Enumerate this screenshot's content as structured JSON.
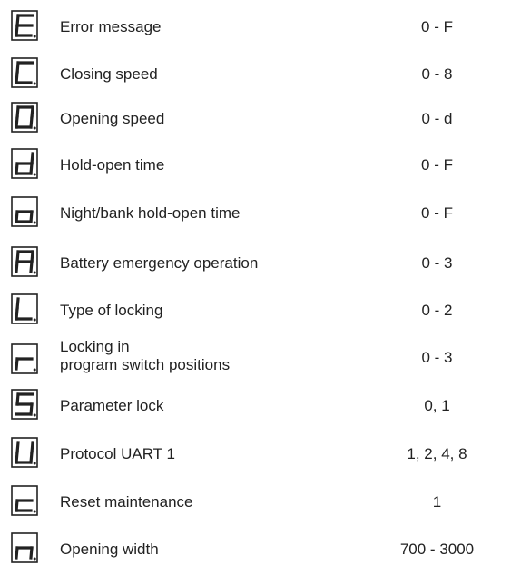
{
  "parameters": [
    {
      "symbol": "E",
      "label": "Error message",
      "range": "0 - F"
    },
    {
      "symbol": "C",
      "label": "Closing speed",
      "range": "0 - 8"
    },
    {
      "symbol": "O",
      "label": "Opening speed",
      "range": "0 - d"
    },
    {
      "symbol": "d",
      "label": "Hold-open time",
      "range": "0 - F"
    },
    {
      "symbol": "o",
      "label": "Night/bank hold-open time",
      "range": "0 - F"
    },
    {
      "symbol": "A",
      "label": "Battery emergency operation",
      "range": "0 - 3"
    },
    {
      "symbol": "L",
      "label": "Type of locking",
      "range": "0 - 2"
    },
    {
      "symbol": "r",
      "label": "Locking in program switch positions",
      "label_line1": "Locking in",
      "label_line2": "program switch positions",
      "range": "0 - 3"
    },
    {
      "symbol": "S",
      "label": "Parameter lock",
      "range": "0, 1"
    },
    {
      "symbol": "U",
      "label": "Protocol UART 1",
      "range": "1, 2, 4, 8"
    },
    {
      "symbol": "c",
      "label": "Reset maintenance",
      "range": "1"
    },
    {
      "symbol": "n",
      "label": "Opening width",
      "range": "700 - 3000"
    }
  ]
}
